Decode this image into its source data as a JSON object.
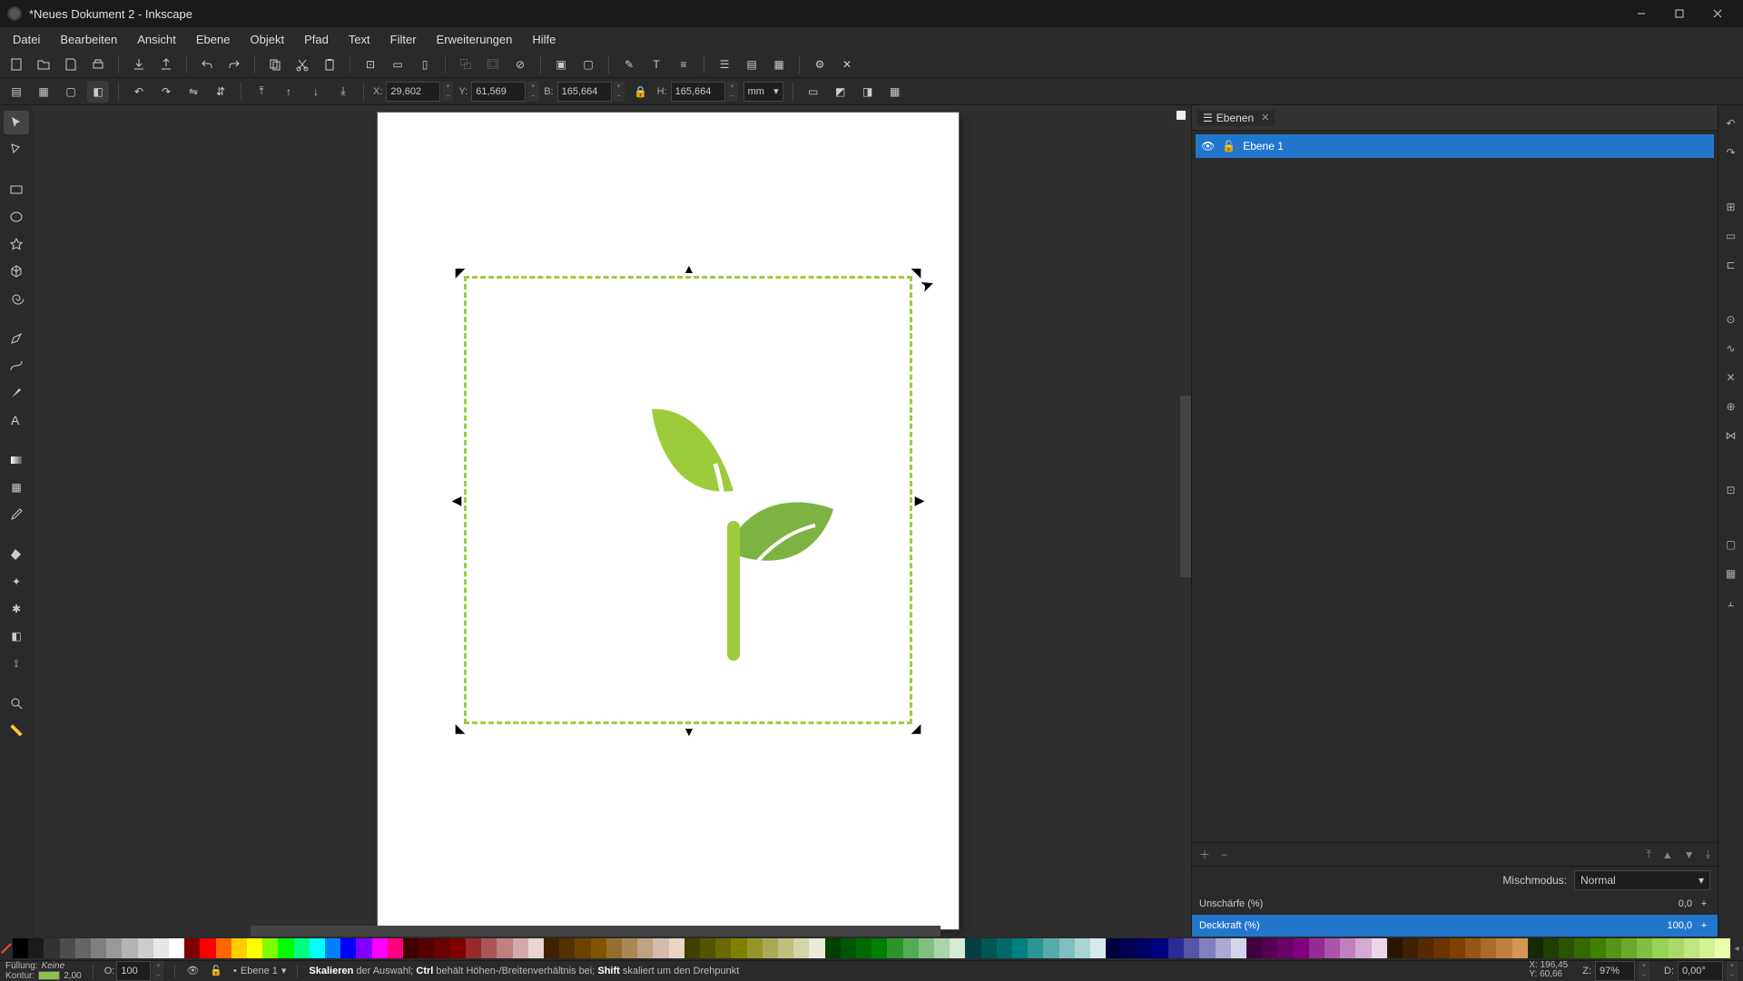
{
  "title": "*Neues Dokument 2 - Inkscape",
  "menu": [
    "Datei",
    "Bearbeiten",
    "Ansicht",
    "Ebene",
    "Objekt",
    "Pfad",
    "Text",
    "Filter",
    "Erweiterungen",
    "Hilfe"
  ],
  "coords": {
    "x_label": "X:",
    "x_val": "29,602",
    "y_label": "Y:",
    "y_val": "61,569",
    "w_label": "B:",
    "w_val": "165,664",
    "h_label": "H:",
    "h_val": "165,664",
    "unit": "mm"
  },
  "panel": {
    "title": "Ebenen",
    "layer_name": "Ebene 1",
    "blend_label": "Mischmodus:",
    "blend_value": "Normal",
    "blur_label": "Unschärfe (%)",
    "blur_value": "0,0",
    "opacity_label": "Deckkraft (%)",
    "opacity_value": "100,0"
  },
  "status": {
    "fill_label": "Füllung:",
    "fill_value": "Keine",
    "stroke_label": "Kontur:",
    "stroke_color": "#8bc34a",
    "stroke_width": "2,00",
    "o_label": "O:",
    "o_val": "100",
    "layer_label": "Ebene 1",
    "msg_action": "Skalieren",
    "msg_mid1": " der Auswahl; ",
    "msg_key1": "Ctrl",
    "msg_mid2": " behält Höhen-/Breitenverhältnis bei; ",
    "msg_key2": "Shift",
    "msg_end": " skaliert um den Drehpunkt",
    "pointer_x_label": "X:",
    "pointer_x": "196,45",
    "pointer_y_label": "Y:",
    "pointer_y": "60,66",
    "zoom_label": "Z:",
    "zoom_val": "97%",
    "rot_label": "D:",
    "rot_val": "0,00°"
  },
  "alpha_label": "O:",
  "palette_colors": [
    "#000000",
    "#1a1a1a",
    "#333333",
    "#4d4d4d",
    "#666666",
    "#808080",
    "#999999",
    "#b3b3b3",
    "#cccccc",
    "#e6e6e6",
    "#ffffff",
    "#800000",
    "#ff0000",
    "#ff6600",
    "#ffcc00",
    "#ffff00",
    "#80ff00",
    "#00ff00",
    "#00ff80",
    "#00ffff",
    "#0080ff",
    "#0000ff",
    "#8000ff",
    "#ff00ff",
    "#ff0080",
    "#400000",
    "#550000",
    "#6a0000",
    "#800000",
    "#952b2b",
    "#aa5555",
    "#bf8080",
    "#d4aaaa",
    "#ead5d5",
    "#402200",
    "#553300",
    "#6a4400",
    "#805500",
    "#956f2b",
    "#aa8855",
    "#bfa280",
    "#d4bbaa",
    "#ead5c4",
    "#404000",
    "#555500",
    "#6a6a00",
    "#808000",
    "#95952b",
    "#aaaa55",
    "#bfbf80",
    "#d4d4aa",
    "#eaead5",
    "#004000",
    "#005500",
    "#006a00",
    "#008000",
    "#2b952b",
    "#55aa55",
    "#80bf80",
    "#aad4aa",
    "#d5ead5",
    "#004040",
    "#005555",
    "#006a6a",
    "#008080",
    "#2b9595",
    "#55aaaa",
    "#80bfbf",
    "#aad4d4",
    "#d5eaea",
    "#000040",
    "#000055",
    "#00006a",
    "#000080",
    "#2b2b95",
    "#5555aa",
    "#8080bf",
    "#aaaad4",
    "#d5d5ea",
    "#400040",
    "#550055",
    "#6a006a",
    "#800080",
    "#952b95",
    "#aa55aa",
    "#bf80bf",
    "#d4aad4",
    "#ead5ea",
    "#2a1500",
    "#3f2000",
    "#552a00",
    "#6a3500",
    "#804000",
    "#955515",
    "#aa6a2b",
    "#bf8040",
    "#d49555",
    "#152a00",
    "#203f00",
    "#2a5500",
    "#356a00",
    "#408000",
    "#559515",
    "#6aaa2b",
    "#80bf40",
    "#95d455",
    "#aad96a",
    "#bfe680",
    "#d4f295",
    "#eaffaa"
  ]
}
